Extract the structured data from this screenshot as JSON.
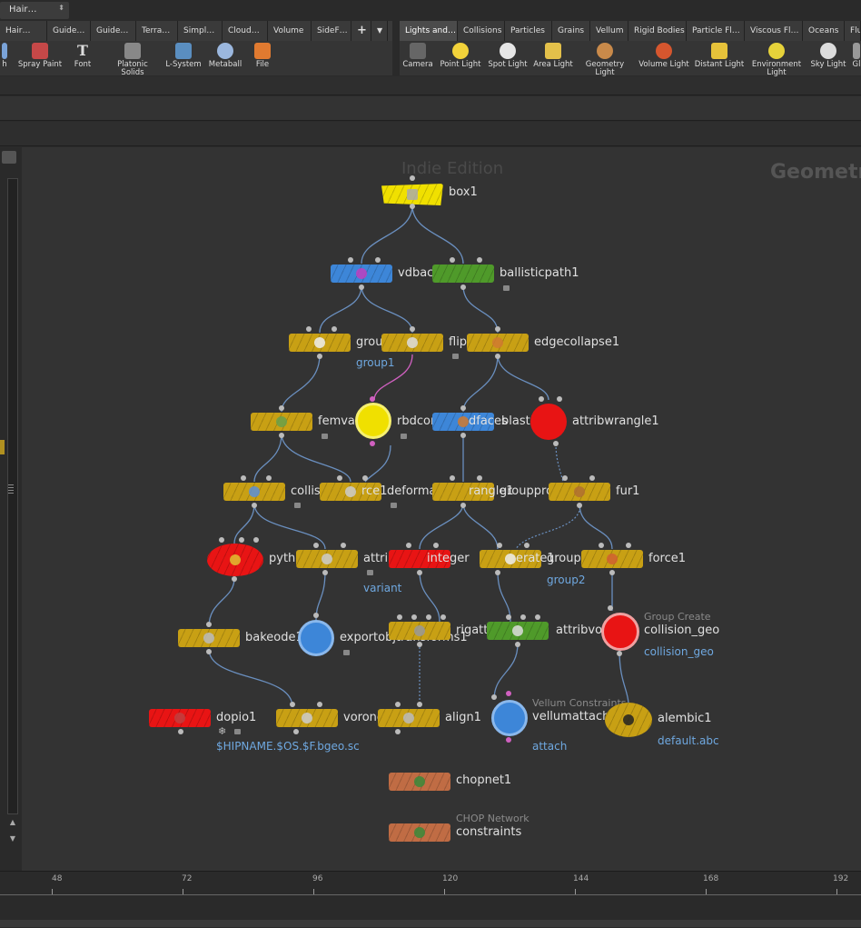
{
  "top_dropdown": {
    "value": "Hair…"
  },
  "shelf_left": {
    "tabs": [
      "Hair…",
      "Guide…",
      "Guide…",
      "Terra…",
      "Simpl…",
      "Cloud…",
      "Volume",
      "SideF…"
    ],
    "add_label": "+",
    "tools": [
      "h",
      "Spray Paint",
      "Font",
      "Platonic Solids",
      "L-System",
      "Metaball",
      "File"
    ]
  },
  "shelf_right": {
    "tabs": [
      "Lights and…",
      "Collisions",
      "Particles",
      "Grains",
      "Vellum",
      "Rigid Bodies",
      "Particle Fl…",
      "Viscous Fl…",
      "Oceans",
      "Flu"
    ],
    "tools": [
      "Camera",
      "Point Light",
      "Spot Light",
      "Area Light",
      "Geometry Light",
      "Volume Light",
      "Distant Light",
      "Environment Light",
      "Sky Light",
      "Gl"
    ]
  },
  "network": {
    "watermark": "Indie Edition",
    "context_label": "Geometr",
    "nodes": {
      "box1": "box1",
      "vdbactivate1": "vdbactivat◦1",
      "ballisticpath1": "ballisticpath1",
      "group1": "group1",
      "group1_sub": "group1",
      "flipsource1": "flipsour◦1",
      "edgecollapse1": "edgecollapse1",
      "femval": "femval",
      "rbdconnect": "rbdconnec",
      "dfaces": "dfaces",
      "blast1": "blast1",
      "attribwrangle1": "attribwrangle1",
      "collisions": "collisions",
      "force1_mid": "rce1",
      "deformation": "deformation",
      "wrangle": "rangle1",
      "grouppromote": "grouppromot",
      "fur1": "fur1",
      "python1": "python1",
      "attribadj": "attribadju",
      "integer": "integer",
      "pointgenerate": "pointgen",
      "erate1": "erate1",
      "group2": "group2",
      "group2_sub": "group2",
      "force1": "force1",
      "variant": "variant",
      "bakeode1": "bakeode1",
      "exportobj": "exportobjtransforms1",
      "rigattribvop": "rigattribvo",
      "attribvop1": "attribvop1",
      "group_create": "Group Create",
      "collision_geo": "collision_geo",
      "collision_geo_sub": "collision_geo",
      "dopio1": "dopio1",
      "dopio1_sub": "$HIPNAME.$OS.$F.bgeo.sc",
      "voronoispl": "voronoispl",
      "align1": "align1",
      "vellum_constraints": "Vellum Constraints",
      "vellumattach1": "vellumattach1",
      "attach": "attach",
      "alembic1": "alembic1",
      "alembic1_sub": "default.abc",
      "chopnet1": "chopnet1",
      "chop_network": "CHOP Network",
      "constraints": "constraints"
    }
  },
  "timeline": {
    "ticks": [
      "48",
      "72",
      "96",
      "120",
      "144",
      "168",
      "192"
    ]
  },
  "colors": {
    "node_gold": "#c8a014",
    "node_blue": "#3d86d8",
    "node_red": "#e81414",
    "node_green": "#4f9a2a",
    "node_chop": "#c06c44",
    "node_box": "#f0e000",
    "wire": "#6a8fbf",
    "wire_pink": "#d060c0"
  }
}
